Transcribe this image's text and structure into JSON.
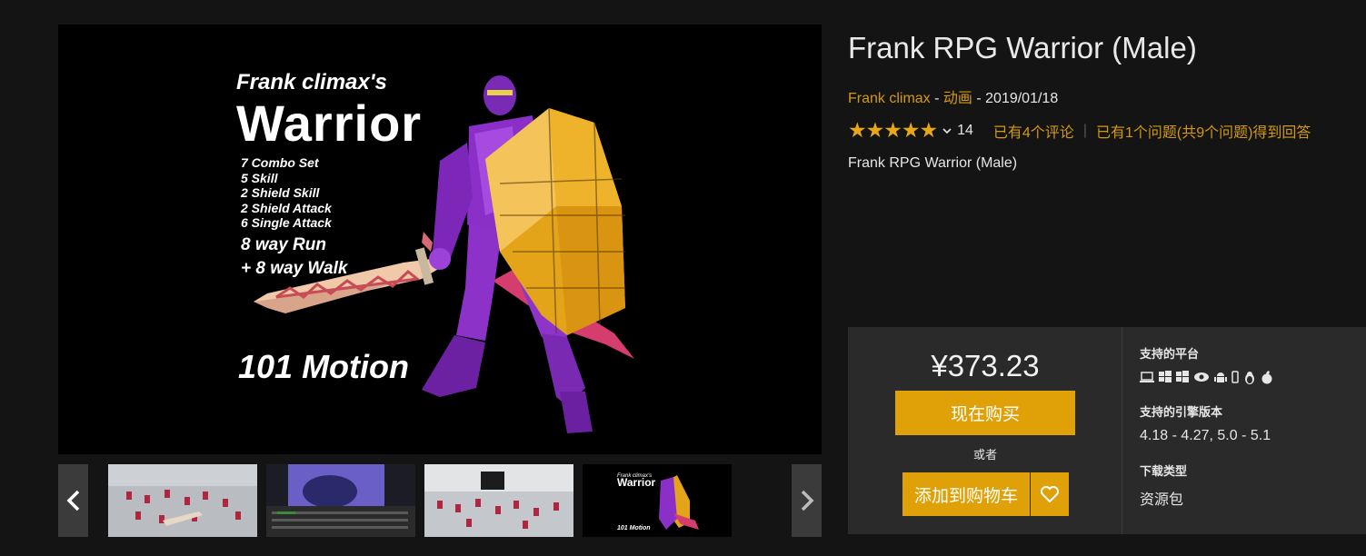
{
  "product": {
    "title": "Frank RPG Warrior (Male)",
    "seller": "Frank climax",
    "category": "动画",
    "date": "2019/01/18",
    "dash1": " - ",
    "dash2": " - ",
    "rating_count": "14",
    "reviews_text": "已有4个评论",
    "questions_text": "已有1个问题(共9个问题)得到回答",
    "subtitle": "Frank RPG Warrior (Male)"
  },
  "hero": {
    "line1": "Frank climax's",
    "line2": "Warrior",
    "features": [
      "7 Combo Set",
      "5 Skill",
      "2 Shield Skill",
      "2 Shield Attack",
      "6 Single Attack"
    ],
    "run1": "8 way Run",
    "run2": "+ 8 way Walk",
    "motion": "101 Motion",
    "shield_text": "Frank climax's",
    "sword_text": "Frank climax's"
  },
  "gallery": {
    "prev_icon": "chevron-left-icon",
    "next_icon": "chevron-right-icon",
    "thumbnails": [
      "thumb-1",
      "thumb-2",
      "thumb-3",
      "thumb-4"
    ]
  },
  "purchase": {
    "price": "¥373.23",
    "buy_label": "现在购买",
    "or_label": "或者",
    "cart_label": "添加到购物车",
    "wishlist_icon": "heart-icon"
  },
  "specs": {
    "platforms_label": "支持的平台",
    "platform_icons": [
      "laptop-icon",
      "windows-icon",
      "windows-icon",
      "eye-icon",
      "android-icon",
      "phone-icon",
      "linux-icon",
      "apple-icon"
    ],
    "engine_label": "支持的引擎版本",
    "engine_versions": "4.18 - 4.27, 5.0 - 5.1",
    "download_label": "下载类型",
    "download_type": "资源包"
  },
  "colors": {
    "accent": "#e0a108",
    "link": "#d39a0f",
    "star": "#e8a816",
    "background": "#141414",
    "panel": "#2a2a2a"
  }
}
